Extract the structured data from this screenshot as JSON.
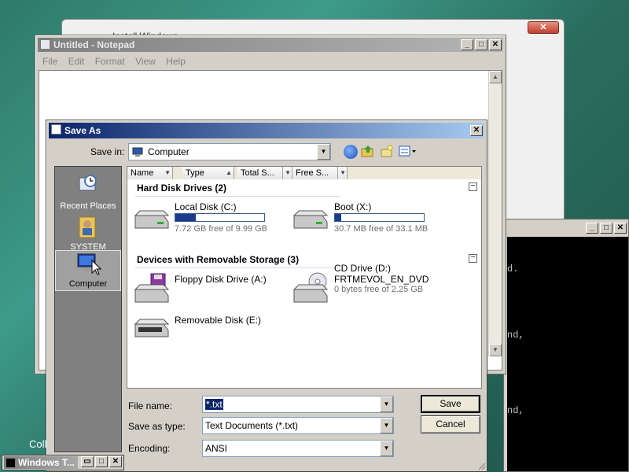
{
  "install_window": {
    "title": "Install Windows",
    "close_label": "✕"
  },
  "cmd_window": {
    "lines": [
      "d.",
      "nd,",
      "nd,"
    ]
  },
  "notepad": {
    "title": "Untitled - Notepad",
    "menu": [
      "File",
      "Edit",
      "Format",
      "View",
      "Help"
    ]
  },
  "save_as": {
    "title": "Save As",
    "save_in_label": "Save in:",
    "save_in_value": "Computer",
    "places": [
      {
        "label": "Recent Places",
        "icon": "recent-places-icon"
      },
      {
        "label": "SYSTEM",
        "icon": "user-folder-icon"
      },
      {
        "label": "Computer",
        "icon": "computer-icon",
        "selected": true
      }
    ],
    "columns": [
      "Name",
      "Type",
      "Total S...",
      "Free S..."
    ],
    "groups": [
      {
        "title": "Hard Disk Drives (2)",
        "items": [
          {
            "name": "Local Disk (C:)",
            "info": "7.72 GB free of 9.99 GB",
            "used_fraction": 0.23
          },
          {
            "name": "Boot (X:)",
            "info": "30.7 MB free of 33.1 MB",
            "used_fraction": 0.07
          }
        ]
      },
      {
        "title": "Devices with Removable Storage (3)",
        "items": [
          {
            "name": "Floppy Disk Drive (A:)"
          },
          {
            "name": "CD Drive (D:)",
            "label": "FRTMEVOL_EN_DVD",
            "info": "0 bytes free of 2.25 GB"
          },
          {
            "name": "Removable Disk (E:)"
          }
        ]
      }
    ],
    "file_name_label": "File name:",
    "file_name_value": "*.txt",
    "save_type_label": "Save as type:",
    "save_type_value": "Text Documents (*.txt)",
    "encoding_label": "Encoding:",
    "encoding_value": "ANSI",
    "save_button": "Save",
    "cancel_button": "Cancel"
  },
  "taskbar": {
    "item_title": "Windows T...",
    "coll_text": "Coll"
  },
  "colors": {
    "selection": "#0a246a",
    "drive_bar": "#1b3a8c"
  }
}
